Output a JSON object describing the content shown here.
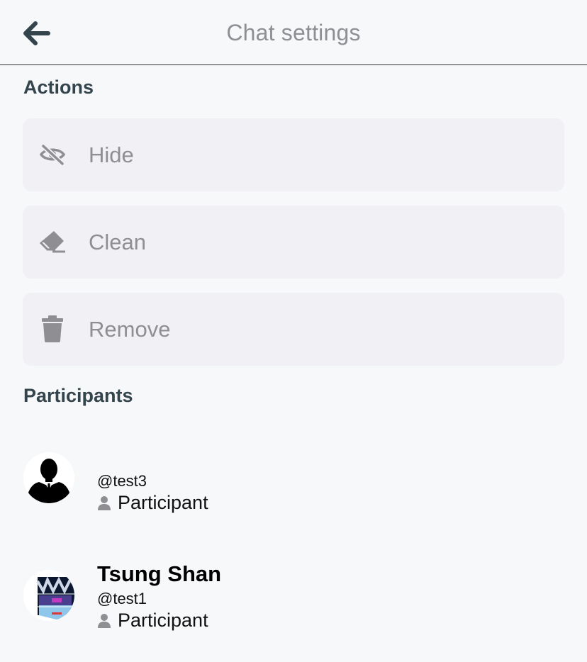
{
  "header": {
    "title": "Chat settings",
    "back_icon": "arrow-left-icon"
  },
  "actions": {
    "section_title": "Actions",
    "items": [
      {
        "label": "Hide",
        "icon": "eye-slash-icon"
      },
      {
        "label": "Clean",
        "icon": "eraser-icon"
      },
      {
        "label": "Remove",
        "icon": "trash-icon"
      }
    ]
  },
  "participants": {
    "section_title": "Participants",
    "items": [
      {
        "name": "",
        "handle": "@test3",
        "role": "Participant",
        "avatar": "silhouette-avatar"
      },
      {
        "name": "Tsung Shan",
        "handle": "@test1",
        "role": "Participant",
        "avatar": "photo-avatar"
      }
    ]
  },
  "colors": {
    "background": "#f7f8fa",
    "row_background": "#f1f1f5",
    "muted_text": "#8e8e93",
    "section_title": "#34444d",
    "back_icon": "#34444d"
  }
}
